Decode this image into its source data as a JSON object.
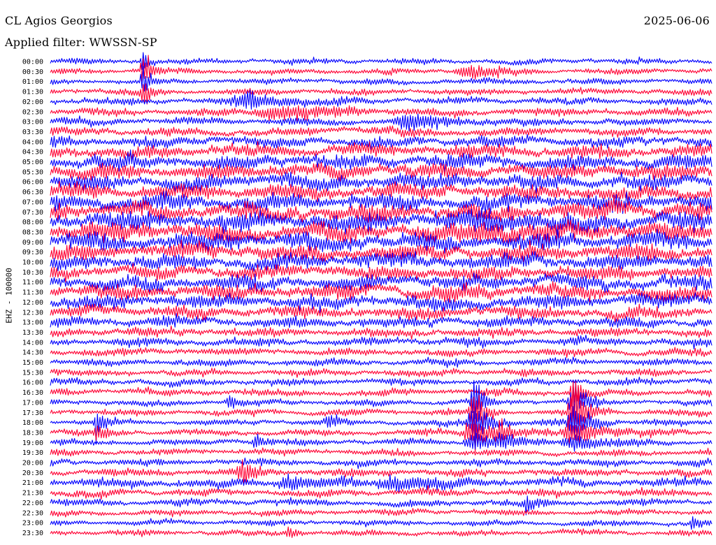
{
  "header": {
    "station": "CL Agios Georgios",
    "date": "2025-06-06",
    "filter": "Applied filter: WWSSN-SP"
  },
  "chart_data": {
    "type": "line",
    "title": "CL Agios Georgios",
    "ylabel": "EHZ - 100000",
    "rows": [
      "00:00",
      "00:30",
      "01:00",
      "01:30",
      "02:00",
      "02:30",
      "03:00",
      "03:30",
      "04:00",
      "04:30",
      "05:00",
      "05:30",
      "06:00",
      "06:30",
      "07:00",
      "07:30",
      "08:00",
      "08:30",
      "09:00",
      "09:30",
      "10:00",
      "10:30",
      "11:00",
      "11:30",
      "12:00",
      "12:30",
      "13:00",
      "13:30",
      "14:00",
      "14:30",
      "15:00",
      "15:30",
      "16:00",
      "16:30",
      "17:00",
      "17:30",
      "18:00",
      "18:30",
      "19:00",
      "19:30",
      "20:00",
      "20:30",
      "21:00",
      "21:30",
      "22:00",
      "22:30",
      "23:00",
      "23:30"
    ],
    "series_colors": [
      "#0000ff",
      "#ff0033"
    ],
    "noise_level": [
      1.0,
      1.0,
      1.0,
      1.1,
      1.2,
      1.3,
      1.3,
      1.5,
      1.8,
      2.2,
      2.5,
      2.6,
      2.6,
      2.6,
      2.8,
      3.0,
      3.1,
      3.1,
      3.0,
      2.8,
      2.6,
      2.4,
      2.5,
      2.6,
      2.4,
      2.1,
      1.8,
      1.5,
      1.4,
      1.3,
      1.2,
      1.2,
      1.2,
      1.2,
      1.1,
      1.1,
      1.1,
      1.1,
      1.1,
      1.1,
      1.2,
      1.3,
      1.6,
      1.3,
      1.2,
      1.1,
      1.0,
      1.0
    ],
    "events": [
      {
        "row": 0,
        "x": 0.14,
        "amp": 6,
        "width": 0.004
      },
      {
        "row": 1,
        "x": 0.14,
        "amp": 9,
        "width": 0.005
      },
      {
        "row": 2,
        "x": 0.14,
        "amp": 6,
        "width": 0.005
      },
      {
        "row": 3,
        "x": 0.14,
        "amp": 5,
        "width": 0.006
      },
      {
        "row": 1,
        "x": 0.63,
        "amp": 3,
        "width": 0.02
      },
      {
        "row": 4,
        "x": 0.3,
        "amp": 3,
        "width": 0.03
      },
      {
        "row": 5,
        "x": 0.34,
        "amp": 3,
        "width": 0.04
      },
      {
        "row": 6,
        "x": 0.54,
        "amp": 3,
        "width": 0.03
      },
      {
        "row": 16,
        "x": 0.66,
        "amp": 2,
        "width": 0.04
      },
      {
        "row": 17,
        "x": 0.66,
        "amp": 2,
        "width": 0.04
      },
      {
        "row": 34,
        "x": 0.27,
        "amp": 4,
        "width": 0.005
      },
      {
        "row": 34,
        "x": 0.64,
        "amp": 9,
        "width": 0.006
      },
      {
        "row": 35,
        "x": 0.64,
        "amp": 10,
        "width": 0.008
      },
      {
        "row": 36,
        "x": 0.64,
        "amp": 8,
        "width": 0.012
      },
      {
        "row": 37,
        "x": 0.64,
        "amp": 6,
        "width": 0.02
      },
      {
        "row": 38,
        "x": 0.64,
        "amp": 4,
        "width": 0.02
      },
      {
        "row": 33,
        "x": 0.79,
        "amp": 9,
        "width": 0.006
      },
      {
        "row": 34,
        "x": 0.79,
        "amp": 10,
        "width": 0.008
      },
      {
        "row": 35,
        "x": 0.79,
        "amp": 10,
        "width": 0.01
      },
      {
        "row": 36,
        "x": 0.79,
        "amp": 9,
        "width": 0.012
      },
      {
        "row": 37,
        "x": 0.79,
        "amp": 6,
        "width": 0.02
      },
      {
        "row": 38,
        "x": 0.79,
        "amp": 4,
        "width": 0.02
      },
      {
        "row": 37,
        "x": 0.68,
        "amp": 6,
        "width": 0.008
      },
      {
        "row": 38,
        "x": 0.68,
        "amp": 4,
        "width": 0.01
      },
      {
        "row": 36,
        "x": 0.07,
        "amp": 5,
        "width": 0.006
      },
      {
        "row": 37,
        "x": 0.07,
        "amp": 3,
        "width": 0.008
      },
      {
        "row": 36,
        "x": 0.42,
        "amp": 3,
        "width": 0.006
      },
      {
        "row": 38,
        "x": 0.31,
        "amp": 3,
        "width": 0.006
      },
      {
        "row": 41,
        "x": 0.29,
        "amp": 4,
        "width": 0.01
      },
      {
        "row": 42,
        "x": 0.36,
        "amp": 3,
        "width": 0.02
      },
      {
        "row": 42,
        "x": 0.52,
        "amp": 3,
        "width": 0.03
      },
      {
        "row": 44,
        "x": 0.72,
        "amp": 4,
        "width": 0.006
      },
      {
        "row": 46,
        "x": 0.97,
        "amp": 3,
        "width": 0.005
      },
      {
        "row": 47,
        "x": 0.36,
        "amp": 3,
        "width": 0.006
      }
    ]
  }
}
